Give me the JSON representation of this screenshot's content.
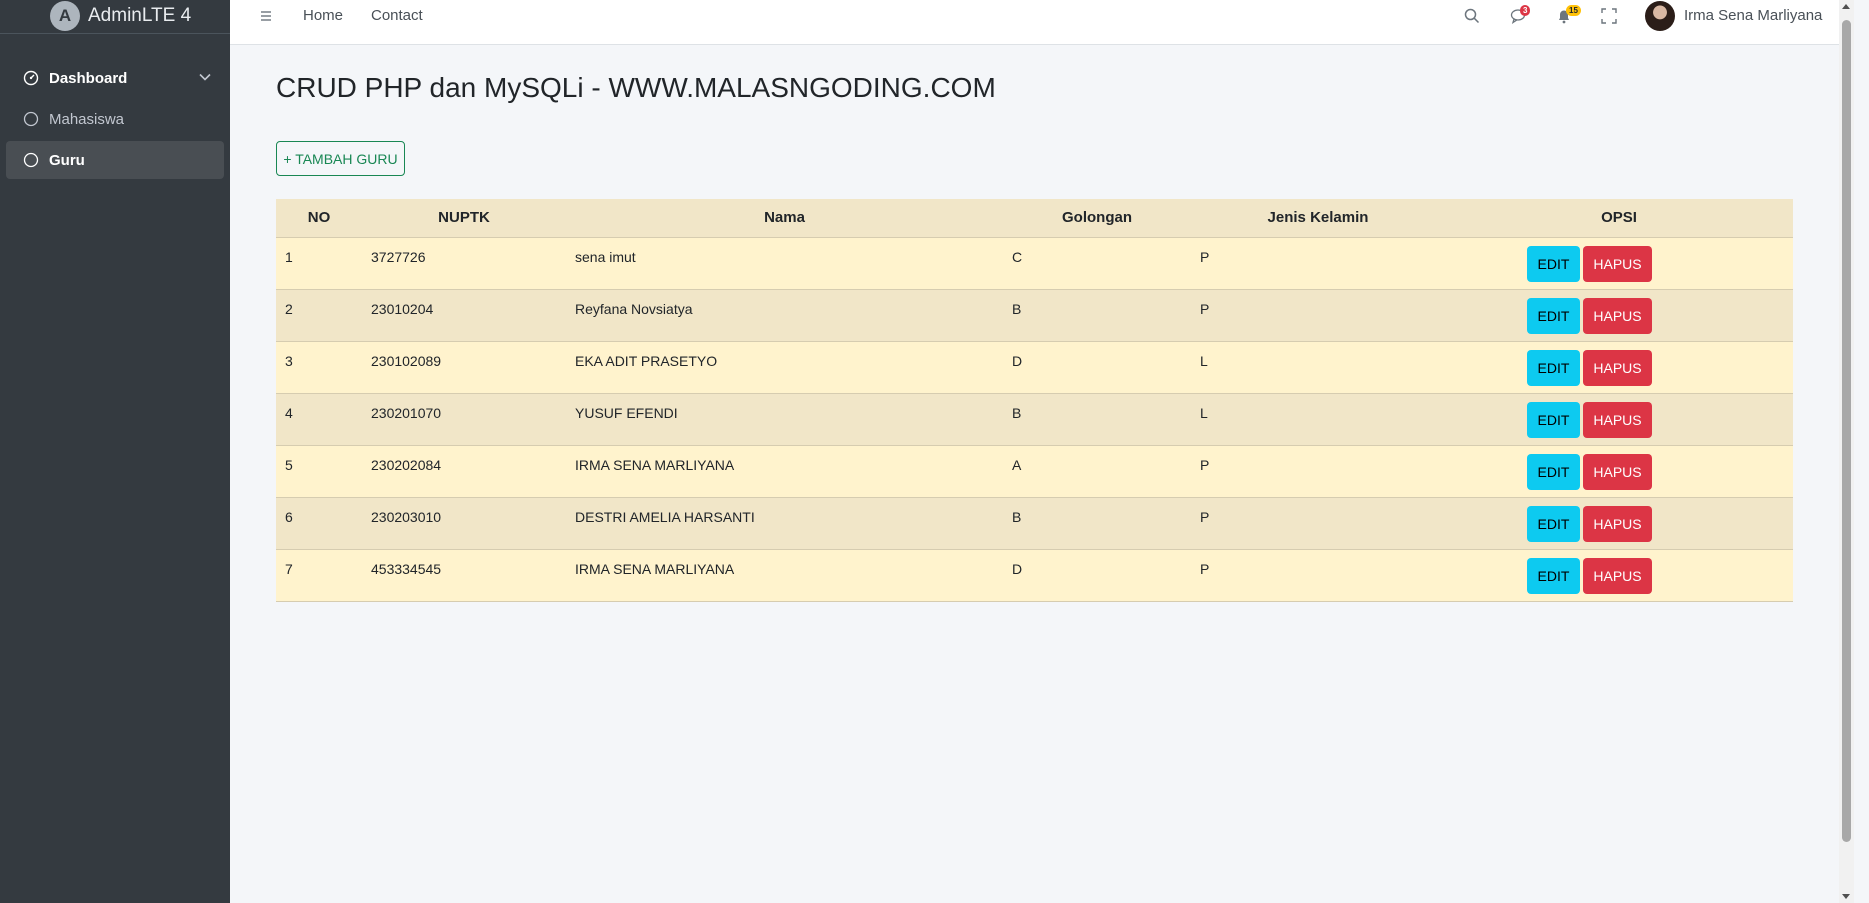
{
  "brand": {
    "logo_letter": "A",
    "title": "AdminLTE 4"
  },
  "sidebar": {
    "items": [
      {
        "label": "Dashboard",
        "icon": "speedometer-icon"
      },
      {
        "label": "Mahasiswa",
        "icon": "circle-icon"
      },
      {
        "label": "Guru",
        "icon": "circle-icon"
      }
    ]
  },
  "navbar": {
    "links": [
      "Home",
      "Contact"
    ],
    "messages_badge": "3",
    "notifications_badge": "15",
    "user_name": "Irma Sena Marliyana"
  },
  "main": {
    "title": "CRUD PHP dan MySQLi - WWW.MALASNGODING.COM",
    "add_button": "+ TAMBAH GURU"
  },
  "table": {
    "headers": [
      "NO",
      "NUPTK",
      "Nama",
      "Golongan",
      "Jenis Kelamin",
      "OPSI"
    ],
    "edit_label": "EDIT",
    "delete_label": "HAPUS",
    "rows": [
      {
        "no": "1",
        "nuptk": "3727726",
        "nama": "sena imut",
        "golongan": "C",
        "jk": "P"
      },
      {
        "no": "2",
        "nuptk": "23010204",
        "nama": "Reyfana Novsiatya",
        "golongan": "B",
        "jk": "P"
      },
      {
        "no": "3",
        "nuptk": "230102089",
        "nama": "EKA ADIT PRASETYO",
        "golongan": "D",
        "jk": "L"
      },
      {
        "no": "4",
        "nuptk": "230201070",
        "nama": "YUSUF EFENDI",
        "golongan": "B",
        "jk": "L"
      },
      {
        "no": "5",
        "nuptk": "230202084",
        "nama": "IRMA SENA MARLIYANA",
        "golongan": "A",
        "jk": "P"
      },
      {
        "no": "6",
        "nuptk": "230203010",
        "nama": "DESTRI AMELIA HARSANTI",
        "golongan": "B",
        "jk": "P"
      },
      {
        "no": "7",
        "nuptk": "453334545",
        "nama": "IRMA SENA MARLIYANA",
        "golongan": "D",
        "jk": "P"
      }
    ]
  },
  "colors": {
    "sidebar_bg": "#343a40",
    "success": "#198754",
    "info": "#0dcaf0",
    "danger": "#dc3545",
    "row_light": "#fff3cd",
    "row_dark": "#f1e6c8"
  }
}
